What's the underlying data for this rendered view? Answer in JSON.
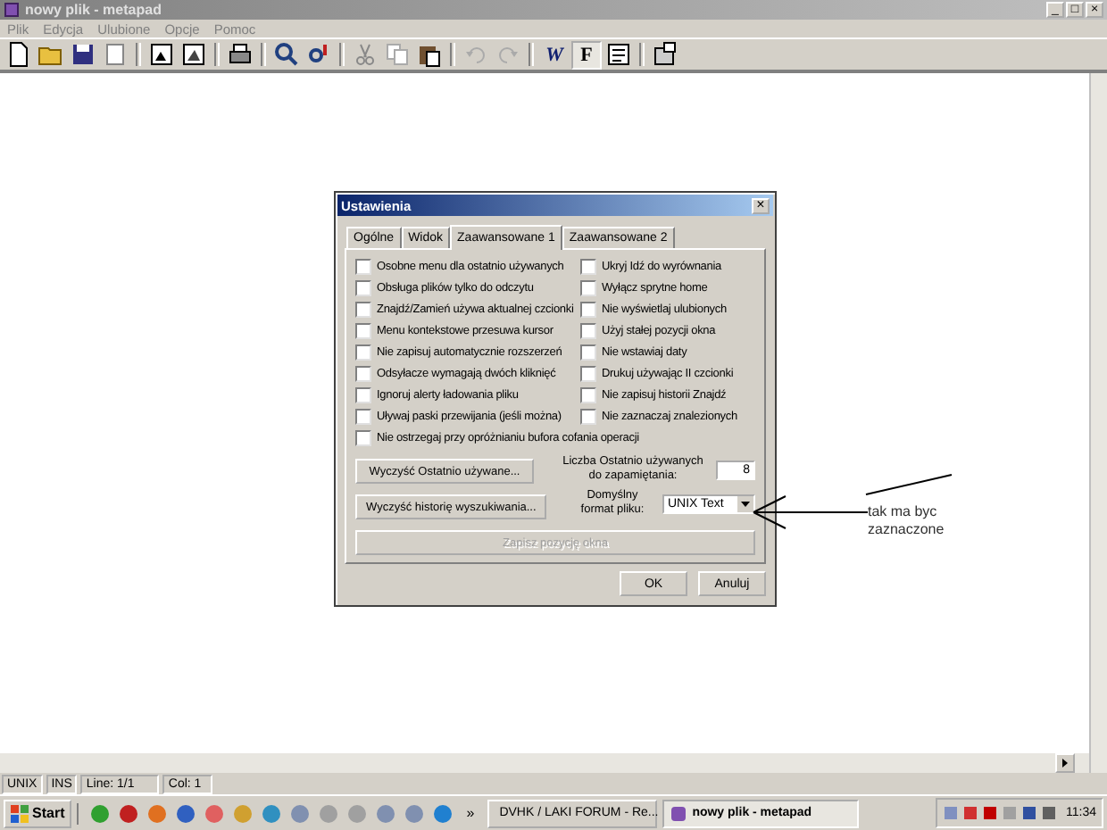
{
  "window": {
    "title": "nowy plik - metapad",
    "controls": [
      "_",
      "□",
      "×"
    ]
  },
  "menu": [
    {
      "label": "Plik"
    },
    {
      "label": "Edycja"
    },
    {
      "label": "Ulubione"
    },
    {
      "label": "Opcje"
    },
    {
      "label": "Pomoc"
    }
  ],
  "toolbar": {
    "word_wrap_button": {
      "glyph": "W",
      "on": false
    },
    "font_button": {
      "glyph": "F",
      "on": true
    }
  },
  "dialog": {
    "title": "Ustawienia",
    "close": "×",
    "tabs": [
      {
        "label": "Ogólne",
        "selected": false
      },
      {
        "label": "Widok",
        "selected": false
      },
      {
        "label": "Zaawansowane 1",
        "selected": true
      },
      {
        "label": "Zaawansowane 2",
        "selected": false
      }
    ],
    "left_options": [
      {
        "label": "Osobne menu dla ostatnio używanych",
        "checked": false
      },
      {
        "label": "Obsługa plików tylko do odczytu",
        "checked": false
      },
      {
        "label": "Znajdź/Zamień używa aktualnej czcionki",
        "checked": false
      },
      {
        "label": "Menu kontekstowe przesuwa kursor",
        "checked": false
      },
      {
        "label": "Nie zapisuj automatycznie rozszerzeń",
        "checked": false
      },
      {
        "label": "Odsyłacze wymagają dwóch kliknięć",
        "checked": false
      },
      {
        "label": "Ignoruj alerty ładowania pliku",
        "checked": false
      },
      {
        "label": "Uływaj paski przewijania (jeśli można)",
        "checked": false
      }
    ],
    "right_options": [
      {
        "label": "Ukryj Idź do wyrównania",
        "checked": false
      },
      {
        "label": "Wyłącz sprytne home",
        "checked": false
      },
      {
        "label": "Nie wyświetlaj ulubionych",
        "checked": false
      },
      {
        "label": "Użyj stałej pozycji okna",
        "checked": false
      },
      {
        "label": "Nie wstawiaj daty",
        "checked": false
      },
      {
        "label": "Drukuj używając II czcionki",
        "checked": false
      },
      {
        "label": "Nie zapisuj historii Znajdź",
        "checked": false
      },
      {
        "label": "Nie zaznaczaj znalezionych",
        "checked": false
      }
    ],
    "wide_option": {
      "label": "Nie ostrzegaj przy opróżnianiu bufora cofania operacji",
      "checked": false
    },
    "clear_recent_button": "Wyczyść Ostatnio używane...",
    "clear_search_button": "Wyczyść historię wyszukiwania...",
    "recent_count": {
      "label": "Liczba Ostatnio używanych do zapamiętania:",
      "value": "8"
    },
    "default_format": {
      "label": "Domyślny format pliku:",
      "value": "UNIX Text"
    },
    "save_position_button": {
      "label": "Zapisz pozycję okna",
      "disabled": true
    },
    "buttons": [
      "OK",
      "Anuluj"
    ]
  },
  "annotation": "tak ma byc zaznaczone",
  "status_bar": [
    "UNIX",
    "INS",
    "Line: 1/1",
    "Col: 1"
  ],
  "taskbar": {
    "start": "Start",
    "more": "»",
    "tasks": [
      {
        "label": "DVHK / LAKI FORUM - Re...",
        "selected": false
      },
      {
        "label": "nowy plik - metapad",
        "selected": true
      }
    ],
    "clock": "11:34"
  }
}
